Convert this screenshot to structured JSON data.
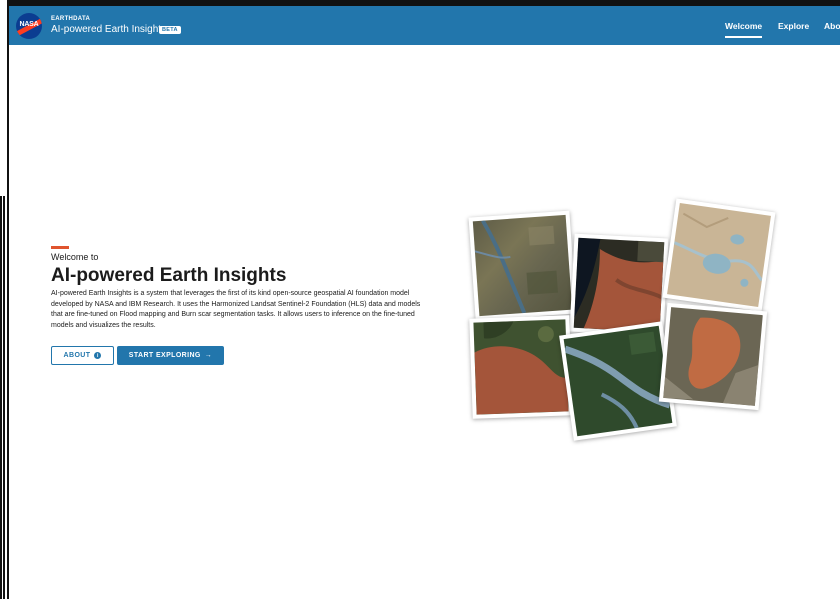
{
  "header": {
    "brand_top": "EARTHDATA",
    "app_title": "AI-powered Earth Insights",
    "beta_badge": "BETA",
    "logo_text": "NASA",
    "nav": [
      {
        "label": "Welcome",
        "active": true
      },
      {
        "label": "Explore",
        "active": false
      },
      {
        "label": "Abo",
        "active": false
      }
    ]
  },
  "hero": {
    "kicker": "Welcome to",
    "title": "AI-powered Earth Insights",
    "description": "AI-powered Earth Insights is a system that leverages the first of its kind open-source geospatial AI foundation model developed by NASA and IBM Research. It uses the Harmonized Landsat Sentinel-2 Foundation (HLS) data and models that are fine-tuned on Flood mapping and Burn scar segmentation tasks. It allows users to inference on the fine-tuned models and visualizes the results.",
    "about_button": "ABOUT",
    "start_button": "START EXPLORING",
    "icons": {
      "about": "info-icon",
      "start": "arrow-right-icon"
    }
  },
  "colors": {
    "primary": "#2276ac",
    "accent": "#e0542e",
    "text": "#1b1b1b"
  },
  "gallery": [
    {
      "name": "satellite-image-river-valley"
    },
    {
      "name": "satellite-image-burn-coast"
    },
    {
      "name": "satellite-image-flood-map"
    },
    {
      "name": "satellite-image-burn-forest"
    },
    {
      "name": "satellite-image-river-forest"
    },
    {
      "name": "satellite-image-burn-mountain"
    }
  ]
}
